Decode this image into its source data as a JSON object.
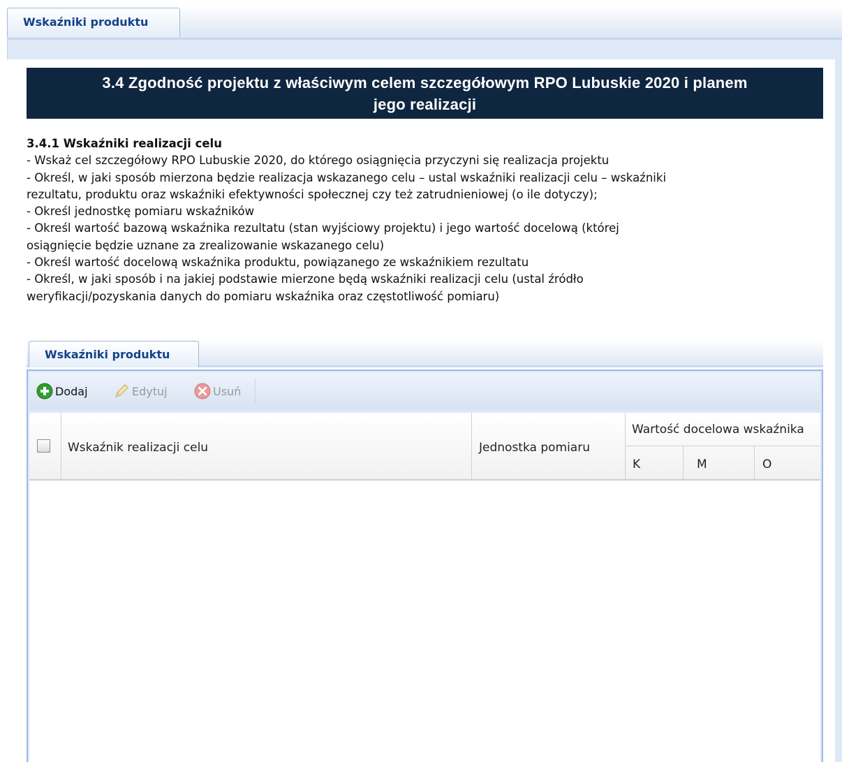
{
  "outer_tab": {
    "label": "Wskaźniki produktu"
  },
  "section": {
    "title_line1": "3.4 Zgodność projektu z właściwym celem szczegółowym RPO Lubuskie 2020 i planem",
    "title_line2": "jego realizacji",
    "subtitle": "3.4.1 Wskaźniki realizacji celu",
    "lines": [
      "- Wskaż cel szczegółowy RPO Lubuskie 2020, do którego osiągnięcia przyczyni się realizacja projektu",
      "- Określ, w jaki sposób mierzona będzie realizacja wskazanego celu – ustal wskaźniki realizacji celu – wskaźniki",
      "rezultatu, produktu oraz wskaźniki efektywności społecznej czy też zatrudnieniowej (o ile dotyczy);",
      "- Określ jednostkę pomiaru wskaźników",
      "- Określ wartość bazową wskaźnika rezultatu (stan wyjściowy projektu) i jego wartość docelową (której",
      "osiągnięcie będzie uznane za zrealizowanie wskazanego celu)",
      "- Określ wartość docelową wskaźnika produktu, powiązanego ze wskaźnikiem rezultatu",
      "- Określ, w jaki sposób i na jakiej podstawie mierzone będą wskaźniki realizacji celu (ustal źródło",
      "weryfikacji/pozyskania danych do pomiaru wskaźnika oraz częstotliwość pomiaru)"
    ]
  },
  "inner_tab": {
    "label": "Wskaźniki produktu"
  },
  "toolbar": {
    "add_label": "Dodaj",
    "edit_label": "Edytuj",
    "delete_label": "Usuń",
    "add_icon": "plus-circle-icon",
    "edit_icon": "pencil-icon",
    "delete_icon": "delete-circle-icon"
  },
  "grid": {
    "columns": {
      "name": "Wskaźnik realizacji celu",
      "unit": "Jednostka pomiaru",
      "target_group": "Wartość docelowa wskaźnika",
      "k": "K",
      "m": "M",
      "o": "O"
    },
    "rows": []
  },
  "colors": {
    "banner_bg": "#0f2640",
    "tab_text": "#15428b",
    "panel_bg": "#dfe8f6",
    "add_green": "#2f9e2f",
    "delete_red": "#e07a7a"
  }
}
